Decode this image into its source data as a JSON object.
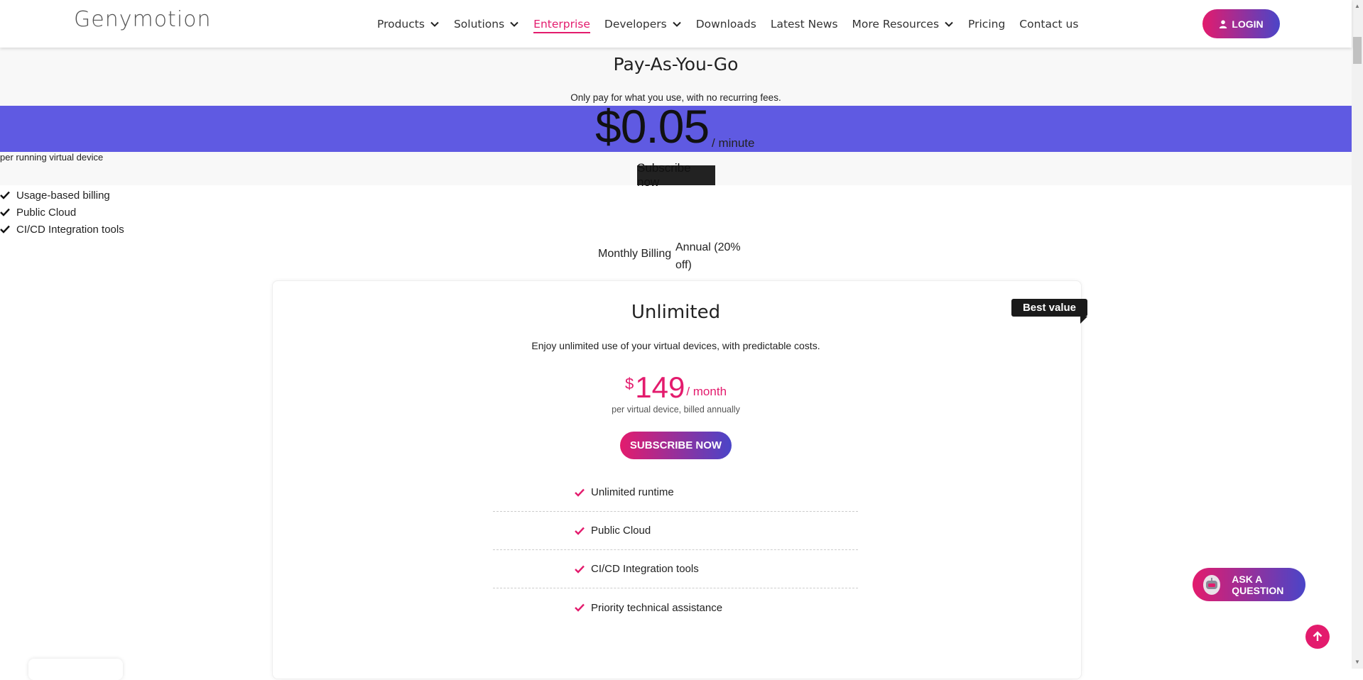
{
  "header": {
    "logo": "Genymotion",
    "nav": [
      {
        "label": "Products",
        "dropdown": true
      },
      {
        "label": "Solutions",
        "dropdown": true
      },
      {
        "label": "Enterprise",
        "dropdown": false,
        "active": true
      },
      {
        "label": "Developers",
        "dropdown": true
      },
      {
        "label": "Downloads",
        "dropdown": false
      },
      {
        "label": "Latest News",
        "dropdown": false
      },
      {
        "label": "More Resources",
        "dropdown": true
      },
      {
        "label": "Pricing",
        "dropdown": false
      },
      {
        "label": "Contact us",
        "dropdown": false
      }
    ],
    "login_label": "LOGIN"
  },
  "payg": {
    "title": "Pay-As-You-Go",
    "subtitle": "Only pay for what you use, with no recurring fees.",
    "price": "$0.05",
    "unit": "/ minute",
    "note": "per running virtual device",
    "subscribe_label": "Subscribe now",
    "features": [
      "Usage-based billing",
      "Public Cloud",
      "CI/CD Integration tools"
    ]
  },
  "billing": {
    "monthly_label": "Monthly Billing",
    "annual_label": "Annual (20% off)"
  },
  "plan": {
    "badge": "Best value",
    "title": "Unlimited",
    "description": "Enjoy unlimited use of your virtual devices, with predictable costs.",
    "currency": "$",
    "amount": "149",
    "unit": "/ month",
    "note": "per virtual device, billed annually",
    "subscribe_label": "SUBSCRIBE NOW",
    "features": [
      "Unlimited runtime",
      "Public Cloud",
      "CI/CD Integration tools",
      "Priority technical assistance"
    ]
  },
  "floating": {
    "ask_label": "ASK A QUESTION"
  },
  "colors": {
    "brand_pink": "#e31b6d",
    "brand_purple": "#4a45c8",
    "price_band": "#5f5ae2"
  }
}
